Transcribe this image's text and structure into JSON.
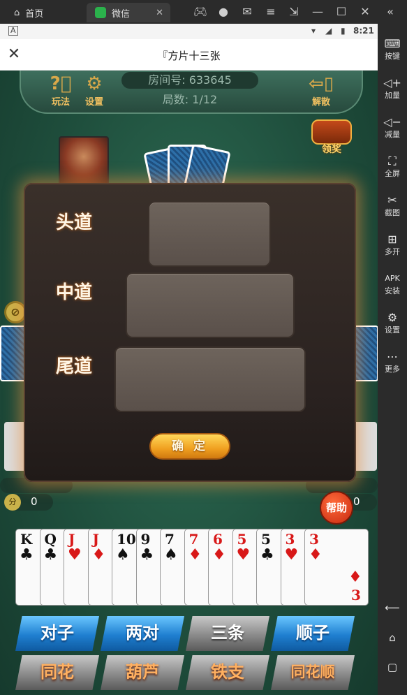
{
  "emulator": {
    "tabs": [
      {
        "label": "首页"
      },
      {
        "label": "微信"
      }
    ],
    "sidebar": [
      {
        "label": "按键",
        "icon": "keyboard-icon"
      },
      {
        "label": "加量",
        "icon": "volume-up-icon"
      },
      {
        "label": "减量",
        "icon": "volume-down-icon"
      },
      {
        "label": "全屏",
        "icon": "fullscreen-icon"
      },
      {
        "label": "截图",
        "icon": "scissors-icon"
      },
      {
        "label": "多开",
        "icon": "multi-instance-icon"
      },
      {
        "label": "安装",
        "icon": "apk-icon"
      },
      {
        "label": "设置",
        "icon": "gear-icon"
      },
      {
        "label": "更多",
        "icon": "more-icon"
      }
    ]
  },
  "statusbar": {
    "time": "8:21"
  },
  "titlebar": {
    "title": "『方片十三张"
  },
  "game": {
    "hud": {
      "rules_label": "玩法",
      "settings_label": "设置",
      "room_number": "房间号: 633645",
      "round": "局数: 1/12",
      "dismiss_label": "解散"
    },
    "reward_label": "领奖",
    "scores": {
      "left": "0",
      "right": "0",
      "score_icon_label": "分"
    },
    "help_label": "帮助"
  },
  "dialog": {
    "rows": [
      {
        "label": "头道"
      },
      {
        "label": "中道"
      },
      {
        "label": "尾道"
      }
    ],
    "confirm_label": "确 定"
  },
  "hand": [
    {
      "rank": "K",
      "suit": "♣",
      "color": "black"
    },
    {
      "rank": "Q",
      "suit": "♣",
      "color": "black"
    },
    {
      "rank": "J",
      "suit": "♥",
      "color": "red"
    },
    {
      "rank": "J",
      "suit": "♦",
      "color": "red"
    },
    {
      "rank": "10",
      "suit": "♠",
      "color": "black"
    },
    {
      "rank": "9",
      "suit": "♣",
      "color": "black"
    },
    {
      "rank": "7",
      "suit": "♠",
      "color": "black"
    },
    {
      "rank": "7",
      "suit": "♦",
      "color": "red"
    },
    {
      "rank": "6",
      "suit": "♦",
      "color": "red"
    },
    {
      "rank": "5",
      "suit": "♥",
      "color": "red"
    },
    {
      "rank": "5",
      "suit": "♣",
      "color": "black"
    },
    {
      "rank": "3",
      "suit": "♥",
      "color": "red"
    },
    {
      "rank": "3",
      "suit": "♦",
      "color": "red"
    }
  ],
  "combos_top": [
    {
      "label": "对子",
      "style": "blue"
    },
    {
      "label": "两对",
      "style": "blue"
    },
    {
      "label": "三条",
      "style": "gray"
    },
    {
      "label": "顺子",
      "style": "blue"
    }
  ],
  "combos_bottom": [
    {
      "label": "同花",
      "style": "gray"
    },
    {
      "label": "葫芦",
      "style": "gray"
    },
    {
      "label": "铁支",
      "style": "gray"
    },
    {
      "label": "同花顺",
      "style": "gray"
    }
  ]
}
